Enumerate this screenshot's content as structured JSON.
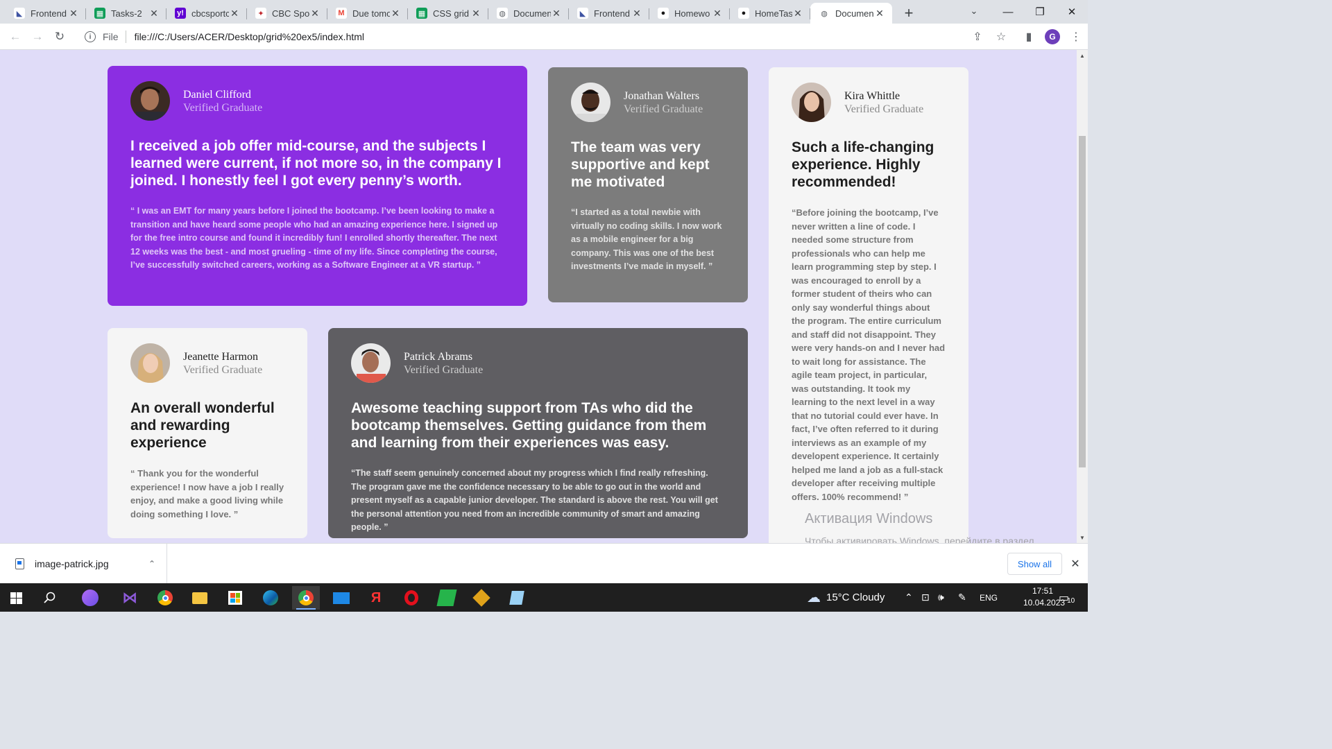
{
  "browser": {
    "tabs": [
      {
        "title": "Frontend",
        "favicon": "frontend-mentor-icon",
        "fav_color": "#ffffff",
        "fav_text": "◣",
        "fav_fg": "#3f54a3"
      },
      {
        "title": "Tasks-2",
        "favicon": "google-sheets-icon",
        "fav_color": "#0f9d58",
        "fav_text": "▦",
        "fav_fg": "#ffffff"
      },
      {
        "title": "cbcsportc",
        "favicon": "yahoo-icon",
        "fav_color": "#6001d2",
        "fav_text": "y!",
        "fav_fg": "#ffffff"
      },
      {
        "title": "CBC Spor",
        "favicon": "cbc-sports-icon",
        "fav_color": "#ffffff",
        "fav_text": "✦",
        "fav_fg": "#c1272d"
      },
      {
        "title": "Due tomo",
        "favicon": "gmail-icon",
        "fav_color": "#ffffff",
        "fav_text": "M",
        "fav_fg": "#ea4335"
      },
      {
        "title": "CSS grid",
        "favicon": "google-sheets-icon",
        "fav_color": "#0f9d58",
        "fav_text": "▦",
        "fav_fg": "#ffffff"
      },
      {
        "title": "Documen",
        "favicon": "globe-icon",
        "fav_color": "#ffffff",
        "fav_text": "◍",
        "fav_fg": "#5f6368"
      },
      {
        "title": "Frontend",
        "favicon": "frontend-mentor-icon",
        "fav_color": "#ffffff",
        "fav_text": "◣",
        "fav_fg": "#3f54a3"
      },
      {
        "title": "Homewo",
        "favicon": "github-icon",
        "fav_color": "#ffffff",
        "fav_text": "●",
        "fav_fg": "#181717"
      },
      {
        "title": "HomeTas",
        "favicon": "github-icon",
        "fav_color": "#ffffff",
        "fav_text": "●",
        "fav_fg": "#181717"
      },
      {
        "title": "Documen",
        "favicon": "globe-icon",
        "fav_color": "#ffffff",
        "fav_text": "◍",
        "fav_fg": "#5f6368",
        "active": true
      }
    ],
    "scheme_label": "File",
    "url": "file:///C:/Users/ACER/Desktop/grid%20ex5/index.html",
    "profile_initial": "G"
  },
  "cards": {
    "daniel": {
      "name": "Daniel Clifford",
      "status": "Verified Graduate",
      "headline": "I received a job offer mid-course, and the subjects I learned were current, if not more so, in the company I joined. I honestly feel I got every penny’s worth.",
      "quote": "“ I was an EMT for many years before I joined the bootcamp. I’ve been looking to make a transition and have heard some people who had an amazing experience here. I signed up for the free intro course and found it incredibly fun! I enrolled shortly thereafter. The next 12 weeks was the best - and most grueling - time of my life. Since completing the course, I’ve successfully switched careers, working as a Software Engineer at a VR startup. ”"
    },
    "jonathan": {
      "name": "Jonathan Walters",
      "status": "Verified Graduate",
      "headline": "The team was very supportive and kept me motivated",
      "quote": "“I started as a total newbie with virtually no coding skills. I now work as a mobile engineer for a big company. This was one of the best investments I’ve made in myself. ”"
    },
    "kira": {
      "name": "Kira Whittle",
      "status": "Verified Graduate",
      "headline": "Such a life-changing experience. Highly recommended!",
      "quote": "“Before joining the bootcamp, I’ve never written a line of code. I needed some structure from professionals who can help me learn programming step by step. I was encouraged to enroll by a former student of theirs who can only say wonderful things about the program. The entire curriculum and staff did not disappoint. They were very hands-on and I never had to wait long for assistance. The agile team project, in particular, was outstanding. It took my learning to the next level in a way that no tutorial could ever have. In fact, I’ve often referred to it during interviews as an example of my developent experience. It certainly helped me land a job as a full-stack developer after receiving multiple offers. 100% recommend! ”"
    },
    "jeanette": {
      "name": "Jeanette Harmon",
      "status": "Verified Graduate",
      "headline": "An overall wonderful and rewarding experience",
      "quote": "“ Thank you for the wonderful experience! I now have a job I really enjoy, and make a good living while doing something I love. ”"
    },
    "patrick": {
      "name": "Patrick Abrams",
      "status": "Verified Graduate",
      "headline": "Awesome teaching support from TAs who did the bootcamp themselves. Getting guidance from them and learning from their experiences was easy.",
      "quote": "“The staff seem genuinely concerned about my progress which I find really refreshing. The program gave me the confidence necessary to be able to go out in the world and present myself as a capable junior developer. The standard is above the rest. You will get the personal attention you need from an incredible community of smart and amazing people. ”"
    }
  },
  "watermark": {
    "title": "Активация Windows",
    "text": "Чтобы активировать Windows, перейдите в раздел \"Параметры\"."
  },
  "downloads": {
    "file_name": "image-patrick.jpg",
    "show_all": "Show all"
  },
  "taskbar": {
    "weather": "15°C  Cloudy",
    "language": "ENG",
    "time": "17:51",
    "date": "10.04.2023",
    "notifications": "10",
    "apps": [
      "start-icon",
      "search-icon",
      "cortana-icon",
      "visual-studio-icon",
      "chrome-icon",
      "file-explorer-icon",
      "microsoft-store-icon",
      "edge-icon",
      "chrome-icon",
      "mail-icon",
      "yandex-icon",
      "opera-icon",
      "green-app-icon",
      "git-icon",
      "notepad-icon"
    ]
  },
  "colors": {
    "page_bg": "#e0dcf8",
    "purple_card": "#8b2ee2",
    "gray_card": "#7c7c7c",
    "dark_card": "#5f5e62",
    "light_card": "#f5f5f5"
  }
}
